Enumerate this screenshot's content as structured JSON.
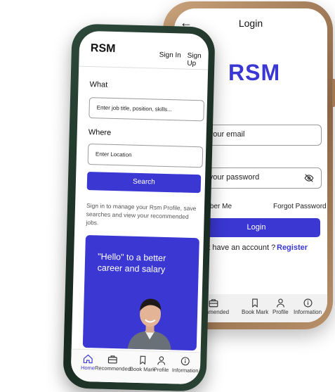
{
  "login_screen": {
    "header_title": "Login",
    "logo": "RSM",
    "email_placeholder": "r your email",
    "password_label": "rd",
    "password_placeholder": "r your password",
    "remember_me": "ember Me",
    "forgot_password": "Forgot Password",
    "login_button": "Login",
    "no_account_text": "n't have an account ?",
    "register_link": "Register",
    "nav": [
      {
        "label": "commended",
        "icon": "briefcase-icon"
      },
      {
        "label": "Book Mark",
        "icon": "bookmark-icon"
      },
      {
        "label": "Profile",
        "icon": "user-icon"
      },
      {
        "label": "Information",
        "icon": "info-icon"
      }
    ]
  },
  "search_screen": {
    "logo": "RSM",
    "sign_in": "Sign In",
    "sign_up": "Sign Up",
    "what_label": "What",
    "what_placeholder": "Enter job title, position, skills...",
    "where_label": "Where",
    "where_placeholder": "Enter Location",
    "search_button": "Search",
    "info_text": "Sign in to manage your Rsm Profile, save searches and view your recommended jobs.",
    "promo_text": "\"Hello\" to a better career and salary",
    "nav": [
      {
        "label": "Home",
        "icon": "home-icon",
        "active": true
      },
      {
        "label": "Recommended",
        "icon": "briefcase-icon"
      },
      {
        "label": "Book Mark",
        "icon": "bookmark-icon"
      },
      {
        "label": "Profile",
        "icon": "user-icon"
      },
      {
        "label": "Information",
        "icon": "info-icon"
      }
    ]
  },
  "colors": {
    "accent": "#3a37d3",
    "back_phone_frame": "#8a6444",
    "front_phone_frame": "#1f3428"
  }
}
